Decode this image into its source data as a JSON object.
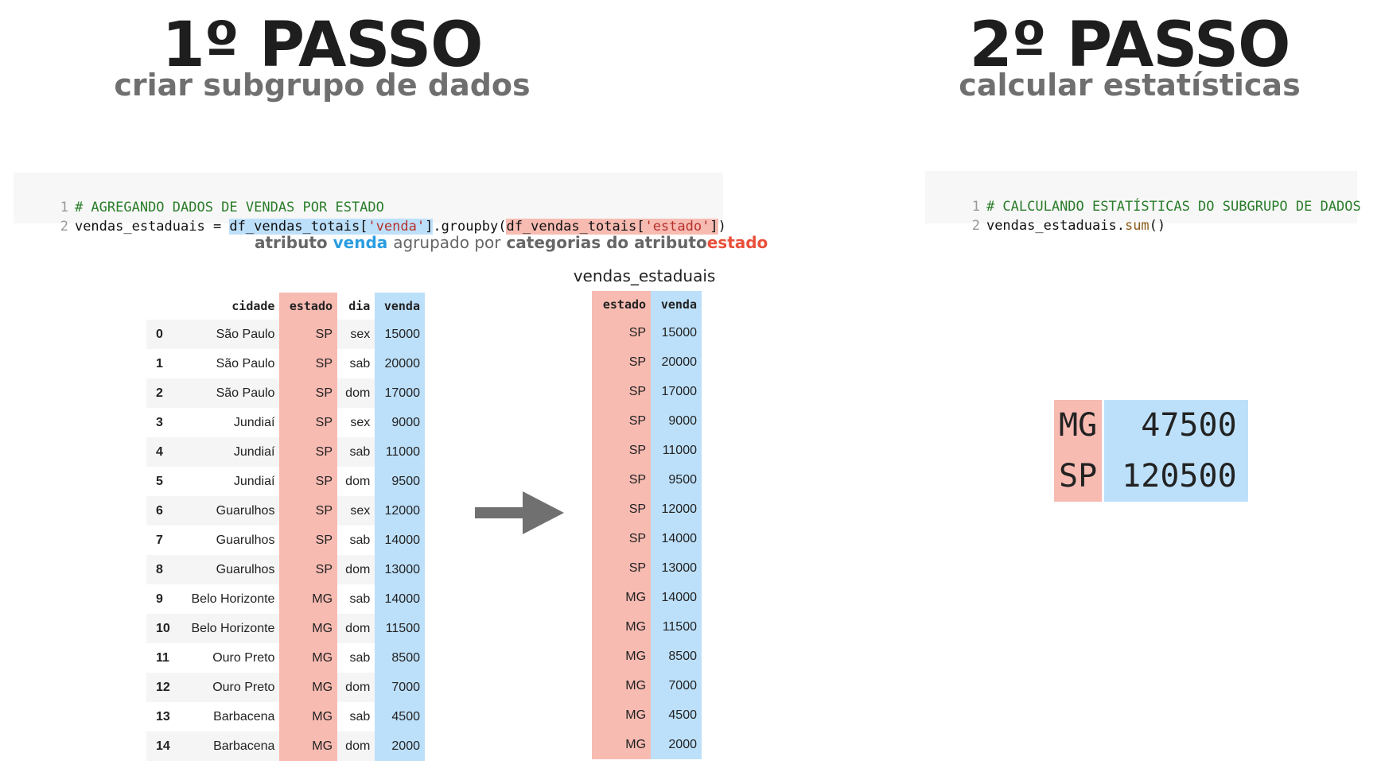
{
  "step1": {
    "title": "1º PASSO",
    "subtitle": "criar subgrupo de dados"
  },
  "step2": {
    "title": "2º PASSO",
    "subtitle": "calcular estatísticas"
  },
  "code1": {
    "line1_no": "1",
    "line1_comment": "# AGREGANDO DADOS DE VENDAS POR ESTADO",
    "line2_no": "2",
    "line2_a": "vendas_estaduais = ",
    "line2_b1": "df_vendas_totais[",
    "line2_b2": "'venda'",
    "line2_b3": "]",
    "line2_c": ".groupby(",
    "line2_d1": "df_vendas_totais[",
    "line2_d2": "'estado'",
    "line2_d3": "]",
    "line2_e": ")"
  },
  "code2": {
    "line1_no": "1",
    "line1_comment": "# CALCULANDO ESTATÍSTICAS DO SUBGRUPO DE DADOS",
    "line2_no": "2",
    "line2_a": "vendas_estaduais.",
    "line2_fn": "sum",
    "line2_b": "()"
  },
  "caption": {
    "p1": "atributo",
    "p2": "venda",
    "p3": "agrupado por",
    "p4": "categorias do atributo",
    "p5": "estado"
  },
  "df": {
    "headers": [
      "",
      "cidade",
      "estado",
      "dia",
      "venda"
    ],
    "rows": [
      [
        "0",
        "São Paulo",
        "SP",
        "sex",
        "15000"
      ],
      [
        "1",
        "São Paulo",
        "SP",
        "sab",
        "20000"
      ],
      [
        "2",
        "São Paulo",
        "SP",
        "dom",
        "17000"
      ],
      [
        "3",
        "Jundiaí",
        "SP",
        "sex",
        "9000"
      ],
      [
        "4",
        "Jundiaí",
        "SP",
        "sab",
        "11000"
      ],
      [
        "5",
        "Jundiaí",
        "SP",
        "dom",
        "9500"
      ],
      [
        "6",
        "Guarulhos",
        "SP",
        "sex",
        "12000"
      ],
      [
        "7",
        "Guarulhos",
        "SP",
        "sab",
        "14000"
      ],
      [
        "8",
        "Guarulhos",
        "SP",
        "dom",
        "13000"
      ],
      [
        "9",
        "Belo Horizonte",
        "MG",
        "sab",
        "14000"
      ],
      [
        "10",
        "Belo Horizonte",
        "MG",
        "dom",
        "11500"
      ],
      [
        "11",
        "Ouro Preto",
        "MG",
        "sab",
        "8500"
      ],
      [
        "12",
        "Ouro Preto",
        "MG",
        "dom",
        "7000"
      ],
      [
        "13",
        "Barbacena",
        "MG",
        "sab",
        "4500"
      ],
      [
        "14",
        "Barbacena",
        "MG",
        "dom",
        "2000"
      ]
    ]
  },
  "grouped": {
    "title": "vendas_estaduais",
    "headers": [
      "estado",
      "venda"
    ],
    "rows": [
      [
        "SP",
        "15000"
      ],
      [
        "SP",
        "20000"
      ],
      [
        "SP",
        "17000"
      ],
      [
        "SP",
        "9000"
      ],
      [
        "SP",
        "11000"
      ],
      [
        "SP",
        "9500"
      ],
      [
        "SP",
        "12000"
      ],
      [
        "SP",
        "14000"
      ],
      [
        "SP",
        "13000"
      ],
      [
        "MG",
        "14000"
      ],
      [
        "MG",
        "11500"
      ],
      [
        "MG",
        "8500"
      ],
      [
        "MG",
        "7000"
      ],
      [
        "MG",
        "4500"
      ],
      [
        "MG",
        "2000"
      ]
    ]
  },
  "result": {
    "rows": [
      [
        "MG",
        "47500"
      ],
      [
        "SP",
        "120500"
      ]
    ]
  },
  "colors": {
    "blue": "#bde0fa",
    "red": "#f7bbb2",
    "arrow": "#707070"
  }
}
